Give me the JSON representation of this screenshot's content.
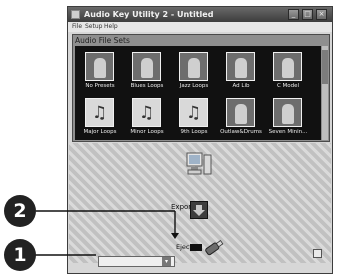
{
  "window": {
    "title": "Audio Key Utility 2 - Untitled",
    "controls": {
      "minimize": "_",
      "maximize": "□",
      "close": "×"
    }
  },
  "menu": [
    "File",
    "Setup",
    "Help"
  ],
  "file_sets": {
    "header": "Audio File Sets",
    "items": [
      {
        "label": "No Presets",
        "kind": "photo"
      },
      {
        "label": "Blues Loops",
        "kind": "photo"
      },
      {
        "label": "Jazz Loops",
        "kind": "photo"
      },
      {
        "label": "Ad Lib",
        "kind": "photo"
      },
      {
        "label": "C Model",
        "kind": "photo"
      },
      {
        "label": "Major Loops",
        "kind": "note"
      },
      {
        "label": "Minor Loops",
        "kind": "note"
      },
      {
        "label": "9th Loops",
        "kind": "note"
      },
      {
        "label": "Outlaw&Drums",
        "kind": "photo"
      },
      {
        "label": "Seven Minin...",
        "kind": "photo"
      }
    ]
  },
  "lower": {
    "export_label": "Export",
    "eject_label": "Eject"
  },
  "callouts": [
    "2",
    "1"
  ],
  "icons": {
    "computer": "computer-icon",
    "export": "export-down-arrow-icon",
    "usb": "usb-key-icon",
    "resize": "resize-icon",
    "music_note": "♫"
  },
  "colors": {
    "titlebar": "#4f4f4f",
    "panel": "#8f8f8f",
    "callout": "#222222"
  }
}
